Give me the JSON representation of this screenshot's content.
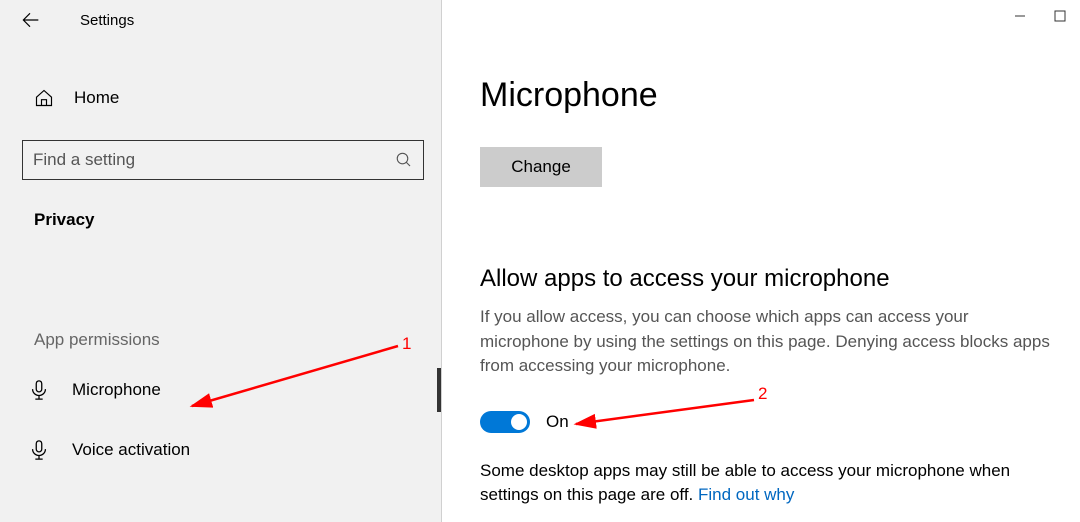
{
  "titlebar": {
    "title": "Settings"
  },
  "sidebar": {
    "home": "Home",
    "search_placeholder": "Find a setting",
    "section": "Privacy",
    "sub_section": "App permissions",
    "items": [
      {
        "label": "Microphone"
      },
      {
        "label": "Voice activation"
      }
    ]
  },
  "main": {
    "title": "Microphone",
    "change_label": "Change",
    "allow_heading": "Allow apps to access your microphone",
    "allow_desc": "If you allow access, you can choose which apps can access your microphone by using the settings on this page. Denying access blocks apps from accessing your microphone.",
    "toggle_state": "On",
    "note_pre": "Some desktop apps may still be able to access your microphone when settings on this page are off. ",
    "note_link": "Find out why"
  },
  "annotations": {
    "one": "1",
    "two": "2"
  }
}
